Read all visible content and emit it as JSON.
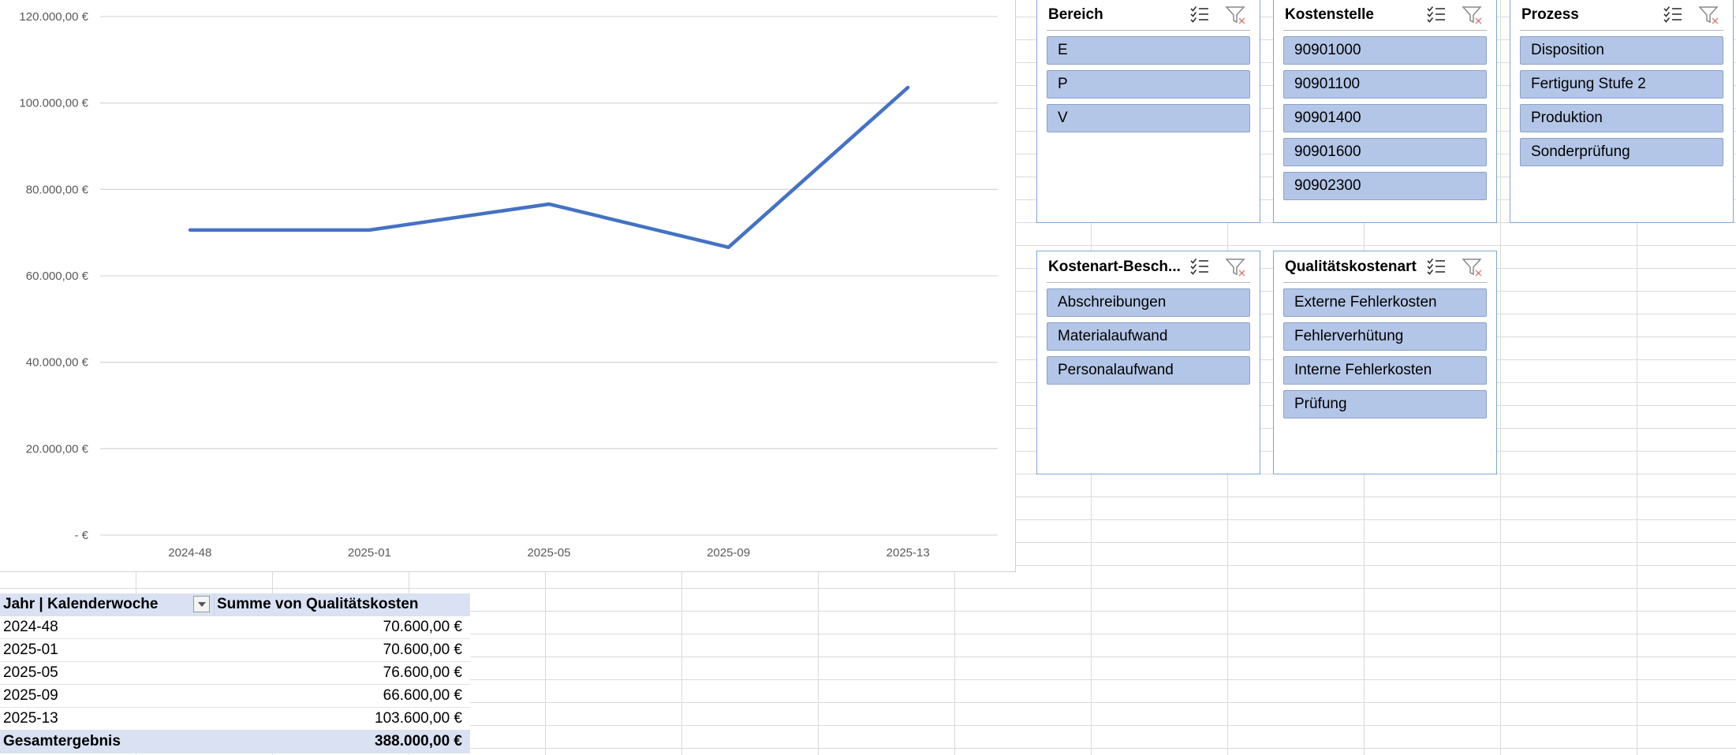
{
  "chart_data": {
    "type": "line",
    "categories": [
      "2024-48",
      "2025-01",
      "2025-05",
      "2025-09",
      "2025-13"
    ],
    "series": [
      {
        "values": [
          70600,
          70600,
          76600,
          66600,
          103600
        ],
        "color": "#4472c4"
      }
    ],
    "ylim": [
      0,
      120000
    ],
    "yticks": [
      "-  €",
      "20.000,00 €",
      "40.000,00 €",
      "60.000,00 €",
      "80.000,00 €",
      "100.000,00 €",
      "120.000,00 €"
    ],
    "ytick_values": [
      0,
      20000,
      40000,
      60000,
      80000,
      100000,
      120000
    ],
    "grid": true,
    "legend": "none"
  },
  "slicers": {
    "bereich": {
      "title": "Bereich",
      "items": [
        "E",
        "P",
        "V"
      ]
    },
    "kostenstelle": {
      "title": "Kostenstelle",
      "items": [
        "90901000",
        "90901100",
        "90901400",
        "90901600",
        "90902300"
      ]
    },
    "prozess": {
      "title": "Prozess",
      "items": [
        "Disposition",
        "Fertigung Stufe 2",
        "Produktion",
        "Sonderprüfung"
      ]
    },
    "kostenart": {
      "title": "Kostenart-Besch...",
      "items": [
        "Abschreibungen",
        "Materialaufwand",
        "Personalaufwand"
      ]
    },
    "qualitaet": {
      "title": "Qualitätskostenart",
      "items": [
        "Externe Fehlerkosten",
        "Fehlerverhütung",
        "Interne Fehlerkosten",
        "Prüfung"
      ]
    }
  },
  "slicer_icons": {
    "multiselect": "multi-select-icon",
    "clear": "clear-filter-icon"
  },
  "pivot": {
    "header": {
      "col1": "Jahr | Kalenderwoche",
      "col2": "Summe von Qualitätskosten"
    },
    "rows": [
      {
        "label": "2024-48",
        "value": "70.600,00 €"
      },
      {
        "label": "2025-01",
        "value": "70.600,00 €"
      },
      {
        "label": "2025-05",
        "value": "76.600,00 €"
      },
      {
        "label": "2025-09",
        "value": "66.600,00 €"
      },
      {
        "label": "2025-13",
        "value": "103.600,00 €"
      }
    ],
    "total": {
      "label": "Gesamtergebnis",
      "value": "388.000,00 €"
    }
  }
}
